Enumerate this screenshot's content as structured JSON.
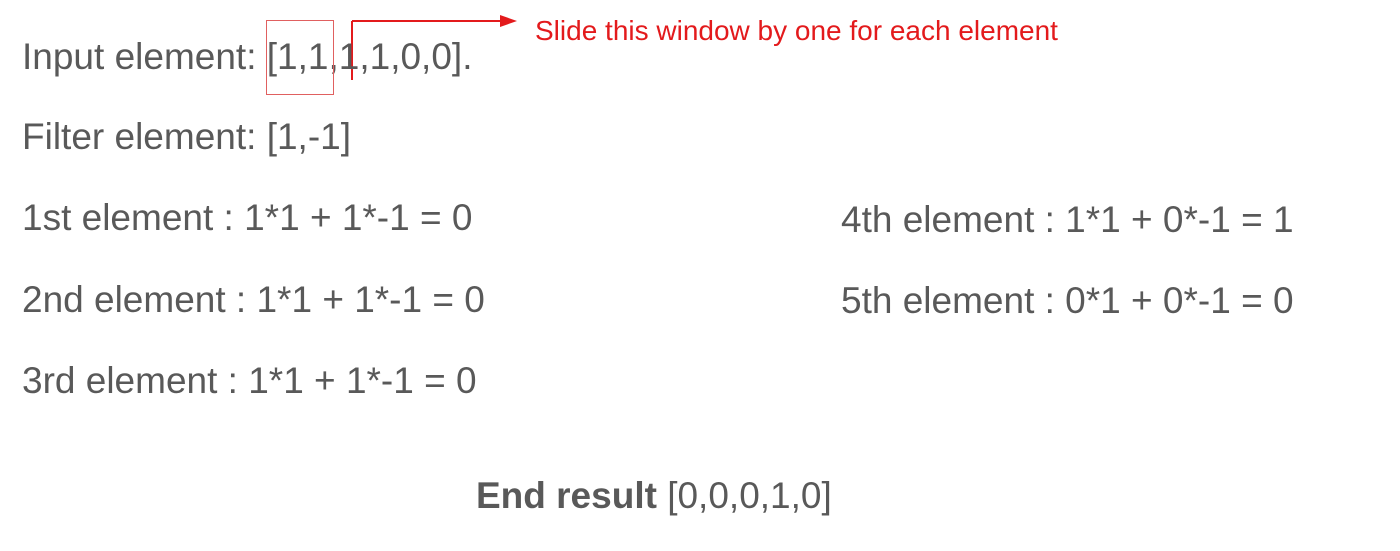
{
  "input": {
    "label": "Input element: ",
    "window": "[1,1",
    "rest": ",1,1,0,0]."
  },
  "filter": {
    "text": "Filter element: [1,-1]"
  },
  "annotation": {
    "text": "Slide this window by one for each element",
    "color": "#e31a1c"
  },
  "calculations": [
    "1st element : 1*1 + 1*-1 = 0",
    "2nd element : 1*1 + 1*-1 = 0",
    "3rd element : 1*1 + 1*-1 = 0",
    "4th element : 1*1 + 0*-1 = 1",
    "5th element : 0*1 + 0*-1 = 0"
  ],
  "result": {
    "label": "End result",
    "value": " [0,0,0,1,0]"
  }
}
